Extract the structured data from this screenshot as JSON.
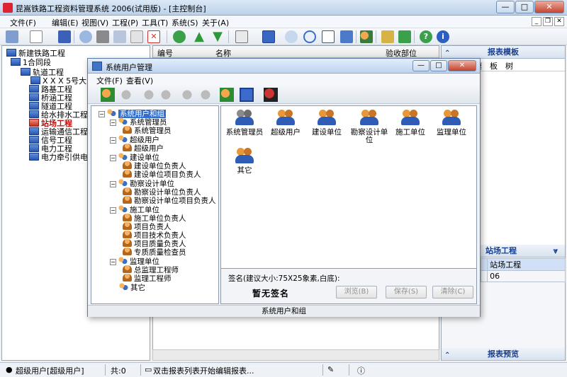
{
  "window": {
    "title": "昆嵩铁路工程资料管理系统 2006(试用版) - [主控制台]"
  },
  "menubar": {
    "items": [
      "文件(F)",
      "编辑(E)",
      "视图(V)",
      "工程(P)",
      "工具(T)",
      "系统(S)",
      "关于(A)"
    ]
  },
  "left_tree": {
    "nodes": [
      {
        "label": "新建铁路工程"
      },
      {
        "label": "1合同段"
      },
      {
        "label": "轨道工程"
      },
      {
        "label": "X X X 5号大"
      },
      {
        "label": "路基工程"
      },
      {
        "label": "桥涵工程"
      },
      {
        "label": "隧道工程"
      },
      {
        "label": "给水排水工程"
      },
      {
        "label": "站场工程"
      },
      {
        "label": "运输通信工程"
      },
      {
        "label": "信号工程"
      },
      {
        "label": "电力工程"
      },
      {
        "label": "电力牵引供电工"
      }
    ]
  },
  "center_grid": {
    "columns": [
      "编号",
      "名称",
      "验收部位"
    ]
  },
  "right_panel": {
    "report_template_title": "报表模板",
    "tabs": [
      "模",
      "板",
      "树"
    ],
    "section_title": "站场工程",
    "table": [
      [
        "",
        "站场工程"
      ],
      [
        "",
        "06"
      ]
    ],
    "report_preview_title": "报表预览"
  },
  "statusbar": {
    "user": "超级用户[超级用户]",
    "count": "共:0",
    "hint": "双击报表列表开始编辑报表..."
  },
  "dialog": {
    "title": "系统用户管理",
    "menu": [
      "文件(F)",
      "查看(V)"
    ],
    "tree": [
      {
        "label": "系统用户和组"
      },
      {
        "label": "系统管理员"
      },
      {
        "label": "系统管理员"
      },
      {
        "label": "超级用户"
      },
      {
        "label": "超级用户"
      },
      {
        "label": "建设单位"
      },
      {
        "label": "建设单位负责人"
      },
      {
        "label": "建设单位项目负责人"
      },
      {
        "label": "勘察设计单位"
      },
      {
        "label": "勘察设计单位负责人"
      },
      {
        "label": "勘察设计单位项目负责人"
      },
      {
        "label": "施工单位"
      },
      {
        "label": "施工单位负责人"
      },
      {
        "label": "项目负责人"
      },
      {
        "label": "项目技术负责人"
      },
      {
        "label": "项目质量负责人"
      },
      {
        "label": "专质质量检查员"
      },
      {
        "label": "监理单位"
      },
      {
        "label": "总监理工程师"
      },
      {
        "label": "监理工程师"
      },
      {
        "label": "其它"
      }
    ],
    "groups": [
      {
        "label": "系统管理员"
      },
      {
        "label": "超级用户"
      },
      {
        "label": "建设单位"
      },
      {
        "label": "勘察设计单位"
      },
      {
        "label": "施工单位"
      },
      {
        "label": "监理单位"
      },
      {
        "label": "其它"
      }
    ],
    "signature_label": "签名(建议大小:75X25象素,白底):",
    "signature_text": "暂无签名",
    "browse_button": "浏览(B)",
    "save_button": "保存(S)",
    "clear_button": "清除(C)",
    "status": "系统用户和组"
  }
}
